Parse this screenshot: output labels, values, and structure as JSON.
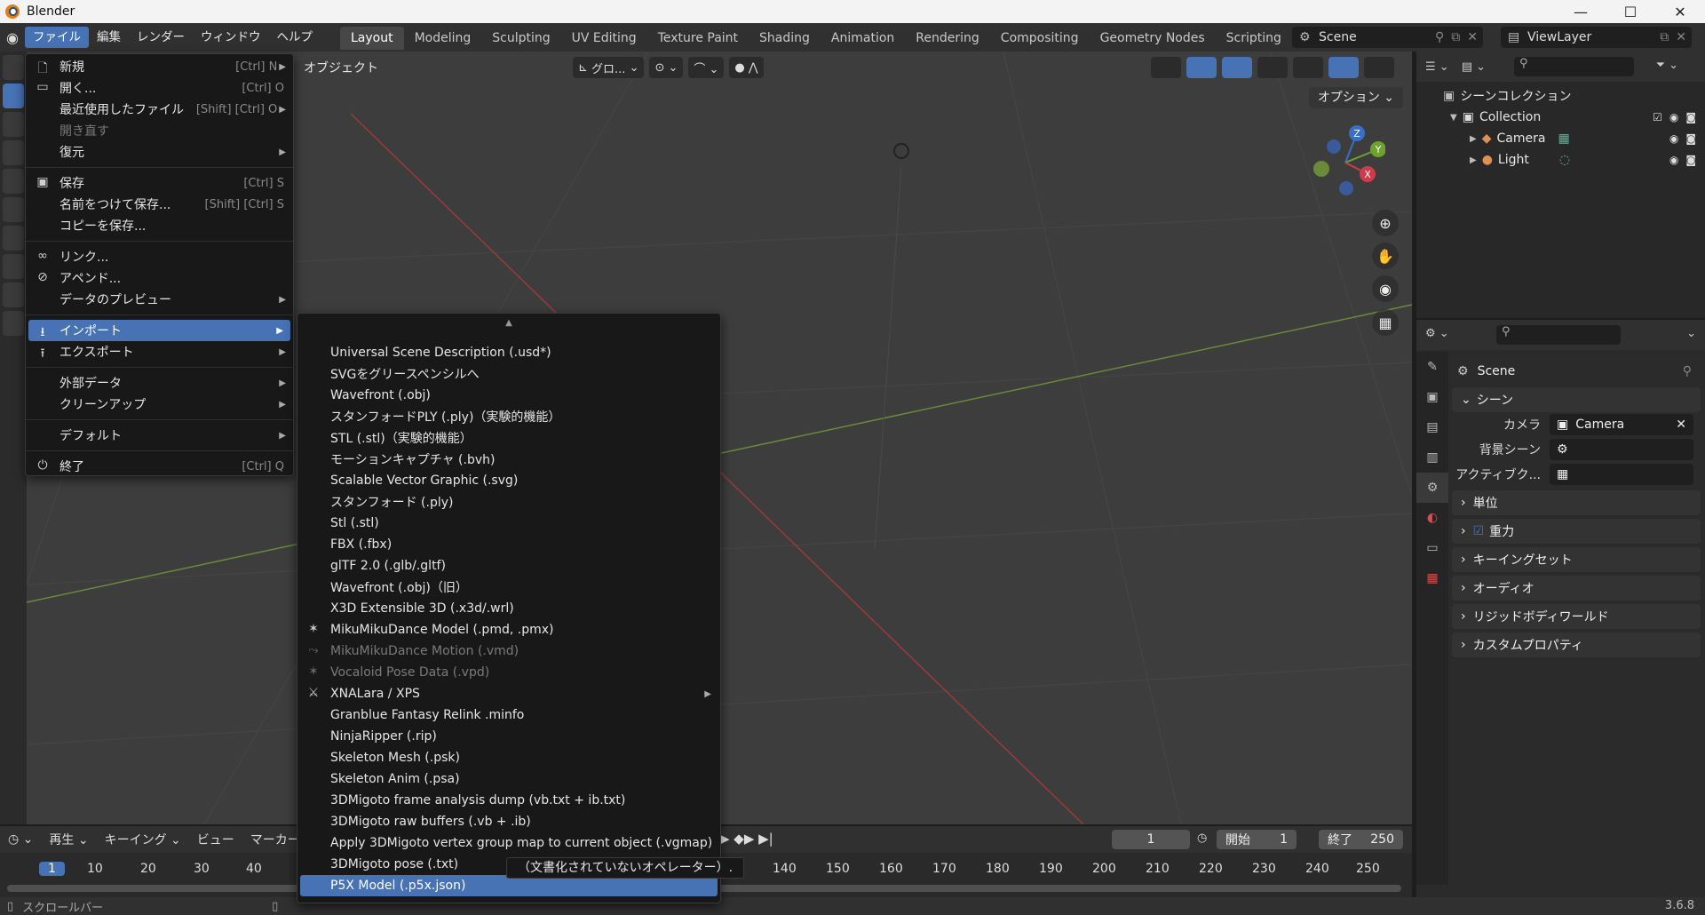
{
  "window": {
    "title": "Blender",
    "min": "—",
    "max": "☐",
    "close": "✕"
  },
  "topbar": {
    "menus": [
      "ファイル",
      "編集",
      "レンダー",
      "ウィンドウ",
      "ヘルプ"
    ],
    "workspaces": [
      "Layout",
      "Modeling",
      "Sculpting",
      "UV Editing",
      "Texture Paint",
      "Shading",
      "Animation",
      "Rendering",
      "Compositing",
      "Geometry Nodes",
      "Scripting"
    ],
    "active_workspace": "Layout",
    "add_workspace": "+",
    "scene": "Scene",
    "view_layer": "ViewLayer"
  },
  "viewport": {
    "mode": "オブジェクト",
    "transform_orientation": "グロ...",
    "options": "オプション",
    "gizmo": {
      "z": "Z",
      "y": "Y",
      "x": "X"
    }
  },
  "file_menu": {
    "items": [
      {
        "label": "新規",
        "shortcut": "[Ctrl] N",
        "icon": "new-file-icon",
        "glyph": "🗋",
        "arrow": true
      },
      {
        "label": "開く...",
        "shortcut": "[Ctrl] O",
        "icon": "folder-icon",
        "glyph": "▭"
      },
      {
        "label": "最近使用したファイル",
        "shortcut": "[Shift] [Ctrl] O",
        "arrow": true
      },
      {
        "label": "開き直す",
        "disabled": true
      },
      {
        "label": "復元",
        "arrow": true
      },
      {
        "sep": true
      },
      {
        "label": "保存",
        "shortcut": "[Ctrl] S",
        "icon": "save-icon",
        "glyph": "▣"
      },
      {
        "label": "名前をつけて保存...",
        "shortcut": "[Shift] [Ctrl] S"
      },
      {
        "label": "コピーを保存..."
      },
      {
        "sep": true
      },
      {
        "label": "リンク...",
        "icon": "link-icon",
        "glyph": "∞"
      },
      {
        "label": "アペンド...",
        "icon": "append-icon",
        "glyph": "⊘"
      },
      {
        "label": "データのプレビュー",
        "arrow": true
      },
      {
        "sep": true
      },
      {
        "label": "インポート",
        "icon": "import-icon",
        "glyph": "⭳",
        "arrow": true,
        "highlight": true
      },
      {
        "label": "エクスポート",
        "icon": "export-icon",
        "glyph": "⭱",
        "arrow": true
      },
      {
        "sep": true
      },
      {
        "label": "外部データ",
        "arrow": true
      },
      {
        "label": "クリーンアップ",
        "arrow": true
      },
      {
        "sep": true
      },
      {
        "label": "デフォルト",
        "arrow": true
      },
      {
        "sep": true
      },
      {
        "label": "終了",
        "shortcut": "[Ctrl] Q",
        "icon": "power-icon",
        "glyph": "⏻"
      }
    ]
  },
  "import_menu": {
    "scroll_up": "▲",
    "items": [
      {
        "label": "Universal Scene Description (.usd*)"
      },
      {
        "label": "SVGをグリースペンシルへ"
      },
      {
        "label": "Wavefront (.obj)"
      },
      {
        "label": "スタンフォードPLY (.ply)（実験的機能）"
      },
      {
        "label": "STL (.stl)（実験的機能）"
      },
      {
        "label": "モーションキャプチャ (.bvh)"
      },
      {
        "label": "Scalable Vector Graphic (.svg)"
      },
      {
        "label": "スタンフォード (.ply)"
      },
      {
        "label": "Stl (.stl)"
      },
      {
        "label": "FBX (.fbx)"
      },
      {
        "label": "glTF 2.0 (.glb/.gltf)"
      },
      {
        "label": "Wavefront (.obj)（旧）"
      },
      {
        "label": "X3D Extensible 3D (.x3d/.wrl)"
      },
      {
        "label": "MikuMikuDance Model (.pmd, .pmx)",
        "icon": "mmd-model-icon",
        "glyph": "✶"
      },
      {
        "label": "MikuMikuDance Motion (.vmd)",
        "disabled": true,
        "icon": "mmd-motion-icon",
        "glyph": "⤳"
      },
      {
        "label": "Vocaloid Pose Data (.vpd)",
        "disabled": true,
        "icon": "vpd-icon",
        "glyph": "✶"
      },
      {
        "label": "XNALara / XPS",
        "arrow": true,
        "icon": "xps-icon",
        "glyph": "⚔"
      },
      {
        "label": "Granblue Fantasy Relink .minfo"
      },
      {
        "label": "NinjaRipper (.rip)"
      },
      {
        "label": "Skeleton Mesh (.psk)"
      },
      {
        "label": "Skeleton Anim (.psa)"
      },
      {
        "label": "3DMigoto frame analysis dump (vb.txt + ib.txt)"
      },
      {
        "label": "3DMigoto raw buffers (.vb + .ib)"
      },
      {
        "label": "Apply 3DMigoto vertex group map to current object (.vgmap)"
      },
      {
        "label": "3DMigoto pose (.txt)"
      },
      {
        "label": "P5X Model (.p5x.json)",
        "highlight": true
      }
    ]
  },
  "tooltip": "（文書化されていないオペレーター）.",
  "timeline": {
    "menus": [
      "再生",
      "キーイング",
      "ビュー",
      "マーカー"
    ],
    "current_frame": "1",
    "start_label": "開始",
    "start": "1",
    "end_label": "終了",
    "end": "250",
    "ruler": [
      "1",
      "10",
      "20",
      "30",
      "40",
      "30",
      "140",
      "150",
      "160",
      "170",
      "180",
      "190",
      "200",
      "210",
      "220",
      "230",
      "240",
      "250"
    ]
  },
  "outliner": {
    "scene_collection": "シーンコレクション",
    "rows": [
      {
        "label": "Collection",
        "indent": 1
      },
      {
        "label": "Camera",
        "indent": 2
      },
      {
        "label": "Light",
        "indent": 2
      }
    ]
  },
  "properties": {
    "title": "Scene",
    "scene_panel": "シーン",
    "camera_label": "カメラ",
    "camera_value": "Camera",
    "bg_scene_label": "背景シーン",
    "active_clip_label": "アクティブク...",
    "panels": [
      "単位",
      "重力",
      "キーイングセット",
      "オーディオ",
      "リジッドボディワールド",
      "カスタムプロパティ"
    ]
  },
  "status": {
    "left": "スクロールバー",
    "version": "3.6.8"
  }
}
